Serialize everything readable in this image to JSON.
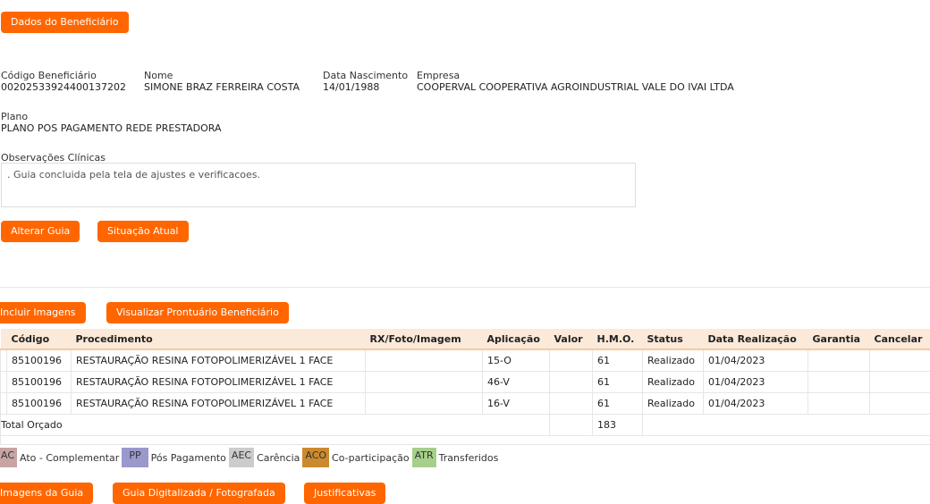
{
  "header": {
    "dados_button": "Dados do Beneficiário"
  },
  "beneficiario": {
    "codigo_label": "Código Beneficiário",
    "codigo_value": "00202533924400137202",
    "nome_label": "Nome",
    "nome_value": "SIMONE BRAZ FERREIRA COSTA",
    "nascimento_label": "Data Nascimento",
    "nascimento_value": "14/01/1988",
    "empresa_label": "Empresa",
    "empresa_value": "COOPERVAL COOPERATIVA AGROINDUSTRIAL VALE DO IVAI LTDA",
    "plano_label": "Plano",
    "plano_value": "PLANO POS PAGAMENTO REDE PRESTADORA",
    "obs_label": "Observações Clínicas",
    "obs_value": ". Guia concluida pela tela de ajustes e verificacoes."
  },
  "actions": {
    "alterar": "Alterar Guia",
    "situacao": "Situação Atual",
    "incluir_imagens": "Incluir Imagens",
    "visualizar_prontuario": "Visualizar Prontuário Beneficiário"
  },
  "table": {
    "headers": [
      "",
      "Código",
      "Procedimento",
      "RX/Foto/Imagem",
      "Aplicação",
      "Valor",
      "H.M.O.",
      "Status",
      "Data Realização",
      "Garantia",
      "Cancelar"
    ],
    "rows": [
      [
        "",
        "85100196",
        "RESTAURAÇÃO RESINA FOTOPOLIMERIZÁVEL 1 FACE",
        "",
        "15-O",
        "",
        "61",
        "Realizado",
        "01/04/2023",
        "",
        ""
      ],
      [
        "",
        "85100196",
        "RESTAURAÇÃO RESINA FOTOPOLIMERIZÁVEL 1 FACE",
        "",
        "46-V",
        "",
        "61",
        "Realizado",
        "01/04/2023",
        "",
        ""
      ],
      [
        "",
        "85100196",
        "RESTAURAÇÃO RESINA FOTOPOLIMERIZÁVEL 1 FACE",
        "",
        "16-V",
        "",
        "61",
        "Realizado",
        "01/04/2023",
        "",
        ""
      ]
    ],
    "total_label": "Total Orçado",
    "total_hmo": "183"
  },
  "legend": [
    {
      "code": "AC",
      "label": "Ato - Complementar",
      "color": "#c9a4a4"
    },
    {
      "code": "PP",
      "label": "Pós Pagamento",
      "color": "#9999cc"
    },
    {
      "code": "AEC",
      "label": "Carência",
      "color": "#cccccc"
    },
    {
      "code": "ACO",
      "label": "Co-participação",
      "color": "#cc8a2e"
    },
    {
      "code": "ATR",
      "label": "Transferidos",
      "color": "#a6d08a"
    }
  ],
  "footer": {
    "imagens_guia": "Imagens da Guia",
    "guia_digitalizada": "Guia Digitalizada / Fotografada",
    "justificativas": "Justificativas"
  }
}
